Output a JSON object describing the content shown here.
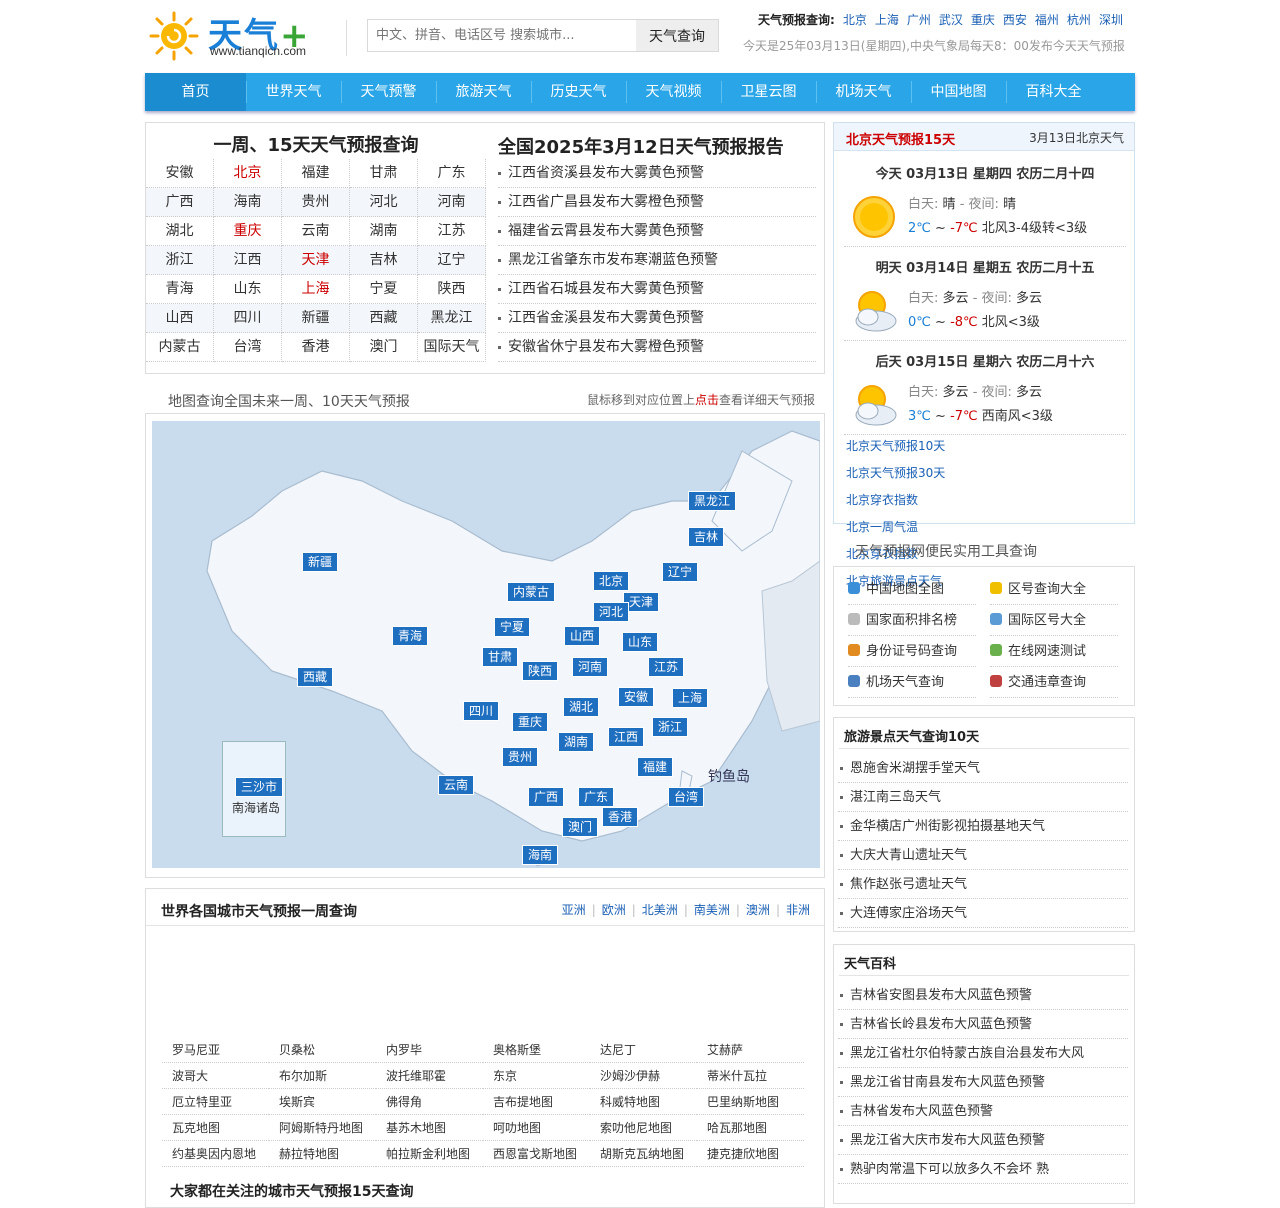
{
  "header": {
    "logo_title": "天气",
    "logo_plus": "+",
    "logo_url": "www.tianqicn.com",
    "search_placeholder": "中文、拼音、电话区号 搜索城市...",
    "search_button": "天气查询",
    "hot_label": "天气预报查询:",
    "hot_cities": [
      "北京",
      "上海",
      "广州",
      "武汉",
      "重庆",
      "西安",
      "福州",
      "杭州",
      "深圳"
    ],
    "notice": "今天是25年03月13日(星期四),中央气象局每天8：00发布今天天气预报"
  },
  "nav": [
    "首页",
    "世界天气",
    "天气预警",
    "旅游天气",
    "历史天气",
    "天气视频",
    "卫星云图",
    "机场天气",
    "中国地图",
    "百科大全"
  ],
  "provinces": {
    "title": "一周、15天天气预报查询",
    "rows": [
      [
        "安徽",
        "北京",
        "福建",
        "甘肃",
        "广东"
      ],
      [
        "广西",
        "海南",
        "贵州",
        "河北",
        "河南"
      ],
      [
        "湖北",
        "重庆",
        "云南",
        "湖南",
        "江苏"
      ],
      [
        "浙江",
        "江西",
        "天津",
        "吉林",
        "辽宁"
      ],
      [
        "青海",
        "山东",
        "上海",
        "宁夏",
        "陕西"
      ],
      [
        "山西",
        "四川",
        "新疆",
        "西藏",
        "黑龙江"
      ],
      [
        "内蒙古",
        "台湾",
        "香港",
        "澳门",
        "国际天气"
      ]
    ],
    "red": [
      "北京",
      "重庆",
      "天津",
      "上海"
    ]
  },
  "warnings": {
    "title": "全国2025年3月12日天气预报报告",
    "items": [
      "江西省资溪县发布大雾黄色预警",
      "江西省广昌县发布大雾橙色预警",
      "福建省云霄县发布大雾黄色预警",
      "黑龙江省肇东市发布寒潮蓝色预警",
      "江西省石城县发布大雾黄色预警",
      "江西省金溪县发布大雾黄色预警",
      "安徽省休宁县发布大雾橙色预警"
    ]
  },
  "map": {
    "caption": "地图查询全国未来一周、10天天气预报",
    "hint_pre": "鼠标移到对应位置上",
    "hint_red": "点击",
    "hint_post": "查看详细天气预报",
    "diaoyu": "钓鱼岛",
    "nanhai": "南海诸岛",
    "markers": [
      "黑龙江",
      "吉林",
      "辽宁",
      "北京",
      "天津",
      "内蒙古",
      "新疆",
      "河北",
      "宁夏",
      "山西",
      "山东",
      "青海",
      "甘肃",
      "陕西",
      "河南",
      "江苏",
      "西藏",
      "安徽",
      "上海",
      "四川",
      "湖北",
      "重庆",
      "浙江",
      "湖南",
      "江西",
      "贵州",
      "福建",
      "云南",
      "广西",
      "广东",
      "台湾",
      "香港",
      "澳门",
      "海南",
      "三沙市"
    ]
  },
  "world": {
    "title": "世界各国城市天气预报一周查询",
    "tabs": [
      "亚洲",
      "欧洲",
      "北美洲",
      "南美洲",
      "澳洲",
      "非洲"
    ],
    "cities": [
      "罗马尼亚",
      "贝桑松",
      "内罗毕",
      "奥格斯堡",
      "达尼丁",
      "艾赫萨",
      "波哥大",
      "布尔加斯",
      "波托维耶霍",
      "东京",
      "沙姆沙伊赫",
      "蒂米什瓦拉",
      "厄立特里亚",
      "埃斯宾",
      "佛得角",
      "吉布提地图",
      "科威特地图",
      "巴里纳斯地图",
      "瓦克地图",
      "阿姆斯特丹地图",
      "基苏木地图",
      "呵叻地图",
      "索叻他尼地图",
      "哈瓦那地图",
      "约基奥因内恩地",
      "赫拉特地图",
      "帕拉斯金利地图",
      "西恩富戈斯地图",
      "胡斯克瓦纳地图",
      "捷克捷欣地图"
    ],
    "bottom_title": "大家都在关注的城市天气预报15天查询"
  },
  "beijing": {
    "title": "北京天气预报15天",
    "date": "3月13日北京天气",
    "days": [
      {
        "head": "今天 03月13日 星期四 农历二月十四",
        "day_label": "白天:",
        "day_w": "晴",
        "night_label": "- 夜间:",
        "night_w": "晴",
        "high": "2℃",
        "sep": "~",
        "low": "-7℃",
        "wind": "北风3-4级转<3级",
        "icon": "sunny-icon"
      },
      {
        "head": "明天 03月14日 星期五 农历二月十五",
        "day_label": "白天:",
        "day_w": "多云",
        "night_label": "- 夜间:",
        "night_w": "多云",
        "high": "0℃",
        "sep": "~",
        "low": "-8℃",
        "wind": "北风<3级",
        "icon": "cloudy-icon"
      },
      {
        "head": "后天 03月15日 星期六 农历二月十六",
        "day_label": "白天:",
        "day_w": "多云",
        "night_label": "- 夜间:",
        "night_w": "多云",
        "high": "3℃",
        "sep": "~",
        "low": "-7℃",
        "wind": "西南风<3级",
        "icon": "cloudy-icon"
      }
    ],
    "links": [
      "北京天气预报10天",
      "北京天气预报30天",
      "北京穿衣指数",
      "北京一周气温",
      "北京穿衣指数",
      "北京旅游景点天气"
    ]
  },
  "tools": {
    "caption": "天气预报网便民实用工具查询",
    "items": [
      "中国地图全图",
      "区号查询大全",
      "国家面积排名榜",
      "国际区号大全",
      "身份证号码查询",
      "在线网速测试",
      "机场天气查询",
      "交通违章查询"
    ]
  },
  "scenic": {
    "title": "旅游景点天气查询10天",
    "items": [
      "恩施舍米湖摆手堂天气",
      "湛江南三岛天气",
      "金华横店广州街影视拍摄基地天气",
      "大庆大青山遗址天气",
      "焦作赵张弓遗址天气",
      "大连傅家庄浴场天气"
    ]
  },
  "baike": {
    "title": "天气百科",
    "items": [
      "吉林省安图县发布大风蓝色预警",
      "吉林省长岭县发布大风蓝色预警",
      "黑龙江省杜尔伯特蒙古族自治县发布大风",
      "黑龙江省甘南县发布大风蓝色预警",
      "吉林省发布大风蓝色预警",
      "黑龙江省大庆市发布大风蓝色预警",
      "熟驴肉常温下可以放多久不会坏 熟"
    ]
  },
  "colors": {
    "nav": "#2aa6e8",
    "nav_active": "#1b8cd0",
    "link": "#1a5fb4",
    "red": "#cc0000",
    "marker": "#1f6fc0",
    "map_sea": "#c9dcee"
  }
}
